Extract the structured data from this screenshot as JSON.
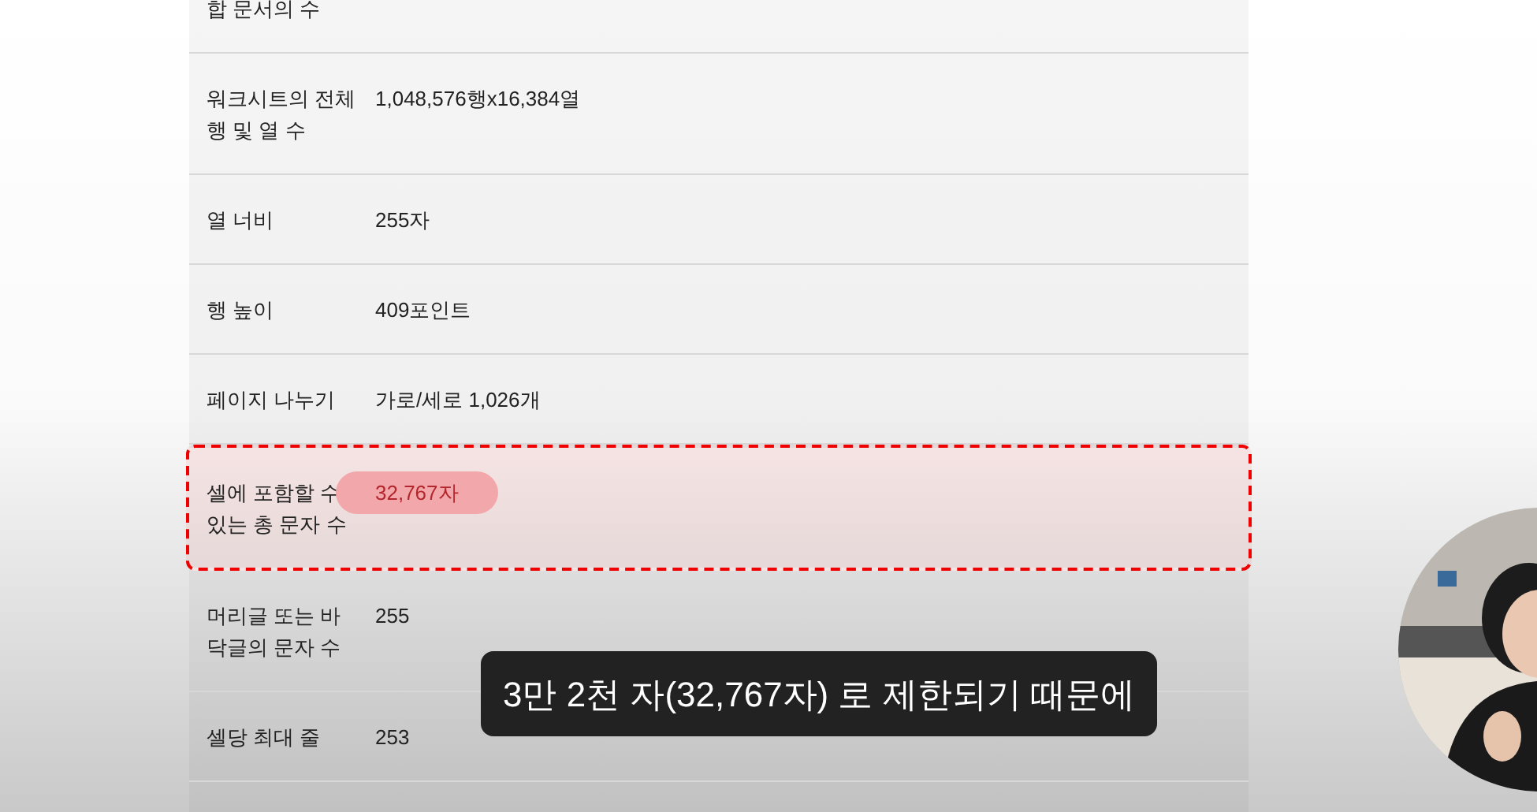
{
  "spec_table": {
    "rows": [
      {
        "label": "합 문서의 수",
        "value": "",
        "highlighted": false
      },
      {
        "label": "워크시트의 전체 행 및 열 수",
        "value": "1,048,576행x16,384열",
        "highlighted": false
      },
      {
        "label": "열 너비",
        "value": "255자",
        "highlighted": false
      },
      {
        "label": "행 높이",
        "value": "409포인트",
        "highlighted": false
      },
      {
        "label": "페이지 나누기",
        "value": "가로/세로 1,026개",
        "highlighted": false
      },
      {
        "label": "셀에 포함할 수 있는 총 문자 수",
        "value": "32,767자",
        "highlighted": true
      },
      {
        "label": "머리글 또는 바닥글의 문자 수",
        "value": "255",
        "highlighted": false
      },
      {
        "label": "셀당 최대 줄",
        "value": "253",
        "highlighted": false
      }
    ]
  },
  "caption": {
    "text": "3만 2천 자(32,767자) 로 제한되기 때문에"
  }
}
